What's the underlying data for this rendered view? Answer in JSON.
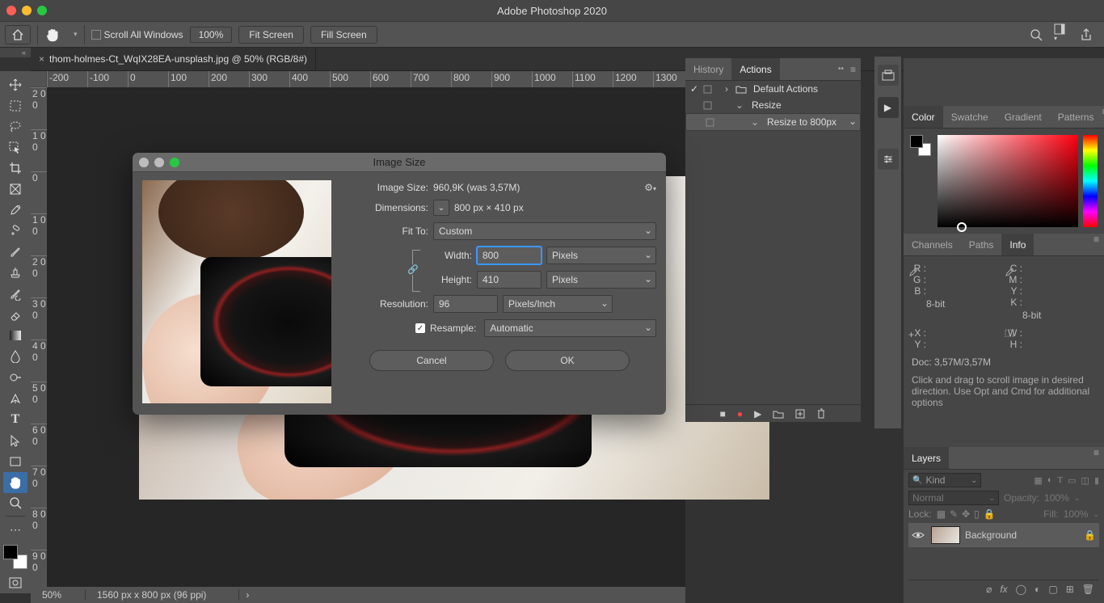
{
  "titlebar": {
    "app_title": "Adobe Photoshop 2020"
  },
  "optbar": {
    "scroll_all": "Scroll All Windows",
    "zoom": "100%",
    "fit_screen": "Fit Screen",
    "fill_screen": "Fill Screen"
  },
  "doc_tab": {
    "label": "thom-holmes-Ct_WqIX28EA-unsplash.jpg @ 50% (RGB/8#)"
  },
  "ruler_h": [
    "-200",
    "-100",
    "0",
    "100",
    "200",
    "300",
    "400",
    "500",
    "600",
    "700",
    "800",
    "900",
    "1000",
    "1100",
    "1200",
    "1300"
  ],
  "ruler_v": [
    "2 0 0",
    "1 0 0",
    "0",
    "1 0 0",
    "2 0 0",
    "3 0 0",
    "4 0 0",
    "5 0 0",
    "6 0 0",
    "7 0 0",
    "8 0 0",
    "9 0 0"
  ],
  "actions_panel": {
    "tabs": {
      "history": "History",
      "actions": "Actions"
    },
    "items": [
      {
        "label": "Default Actions",
        "indent": 0,
        "chev": "›",
        "folder": true,
        "checked": true
      },
      {
        "label": "Resize",
        "indent": 1,
        "chev": "⌄",
        "folder": false,
        "checked": false
      },
      {
        "label": "Resize to 800px",
        "indent": 2,
        "chev": "⌄",
        "folder": false,
        "checked": false,
        "selected": true
      }
    ]
  },
  "color_panel": {
    "tabs": {
      "color": "Color",
      "swatches": "Swatche",
      "gradient": "Gradient",
      "patterns": "Patterns"
    }
  },
  "info_panel": {
    "tabs": {
      "channels": "Channels",
      "paths": "Paths",
      "info": "Info"
    },
    "left": [
      {
        "lbl": "R :",
        "val": ""
      },
      {
        "lbl": "G :",
        "val": ""
      },
      {
        "lbl": "B :",
        "val": ""
      }
    ],
    "right": [
      {
        "lbl": "C :",
        "val": ""
      },
      {
        "lbl": "M :",
        "val": ""
      },
      {
        "lbl": "Y :",
        "val": ""
      },
      {
        "lbl": "K :",
        "val": ""
      }
    ],
    "bit": "8-bit",
    "pos": [
      {
        "lbl": "X :",
        "val": ""
      },
      {
        "lbl": "Y :",
        "val": ""
      }
    ],
    "dim": [
      {
        "lbl": "W :",
        "val": ""
      },
      {
        "lbl": "H :",
        "val": ""
      }
    ],
    "doc": "Doc: 3,57M/3,57M",
    "hint": "Click and drag to scroll image in desired direction.  Use Opt and Cmd for additional options"
  },
  "layers_panel": {
    "tab": "Layers",
    "kind": "Kind",
    "blend": "Normal",
    "opacity_lbl": "Opacity:",
    "opacity_val": "100%",
    "lock_lbl": "Lock:",
    "fill_lbl": "Fill:",
    "fill_val": "100%",
    "layer_name": "Background"
  },
  "statusbar": {
    "zoom": "50%",
    "dims": "1560 px x 800 px (96 ppi)"
  },
  "modal": {
    "title": "Image Size",
    "size_lbl": "Image Size:",
    "size_val": "960,9K (was 3,57M)",
    "dim_lbl": "Dimensions:",
    "dim_val": "800 px  ×  410 px",
    "fit_lbl": "Fit To:",
    "fit_val": "Custom",
    "width_lbl": "Width:",
    "width_val": "800",
    "width_unit": "Pixels",
    "height_lbl": "Height:",
    "height_val": "410",
    "height_unit": "Pixels",
    "res_lbl": "Resolution:",
    "res_val": "96",
    "res_unit": "Pixels/Inch",
    "resample_lbl": "Resample:",
    "resample_val": "Automatic",
    "cancel": "Cancel",
    "ok": "OK"
  }
}
